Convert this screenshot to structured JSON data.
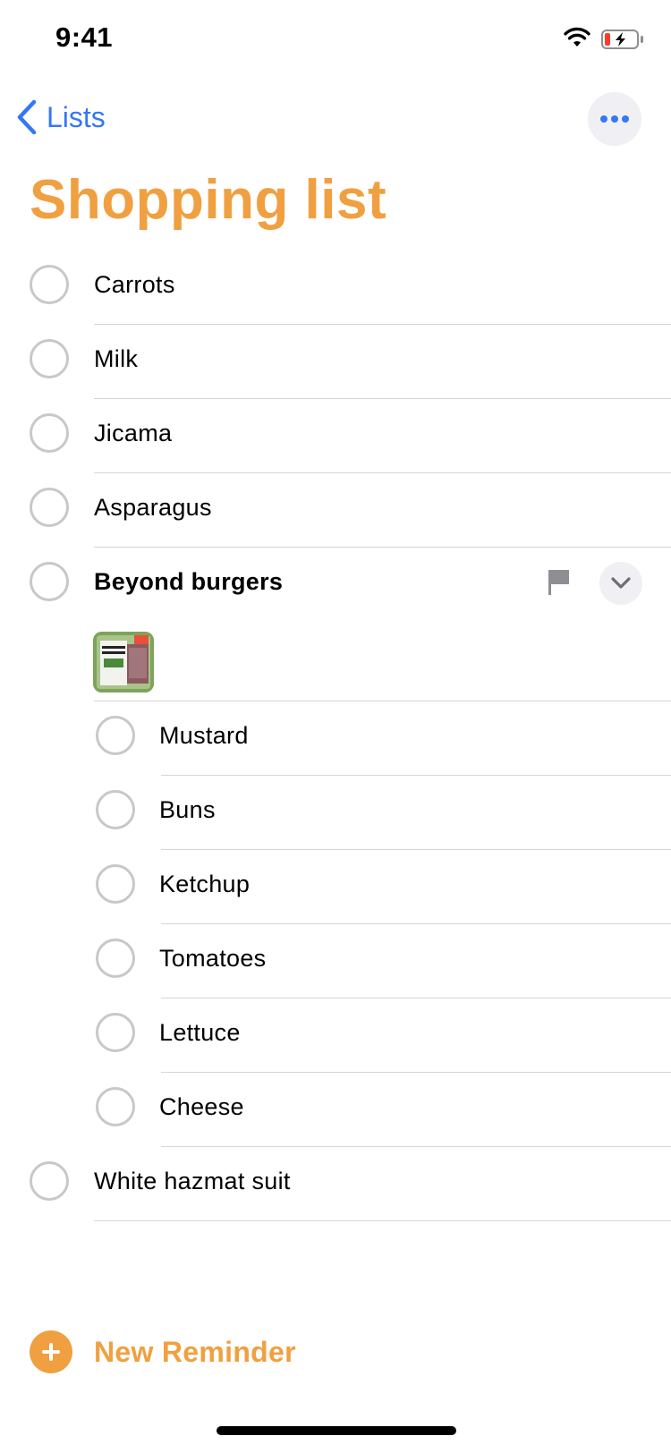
{
  "status_bar": {
    "time": "9:41"
  },
  "nav": {
    "back_label": "Lists",
    "more_icon": "ellipsis-icon"
  },
  "title": "Shopping list",
  "colors": {
    "accent": "#f0a040",
    "link": "#3478f6",
    "circle": "#c8c8cc",
    "separator": "#d6d6da"
  },
  "reminders": [
    {
      "label": "Carrots"
    },
    {
      "label": "Milk"
    },
    {
      "label": "Jicama"
    },
    {
      "label": "Asparagus"
    },
    {
      "label": "Beyond burgers",
      "flagged": true,
      "expanded": true,
      "has_attachment": true
    },
    {
      "label": "White hazmat suit"
    }
  ],
  "subtasks": [
    {
      "label": "Mustard"
    },
    {
      "label": "Buns"
    },
    {
      "label": "Ketchup"
    },
    {
      "label": "Tomatoes"
    },
    {
      "label": "Lettuce"
    },
    {
      "label": "Cheese"
    }
  ],
  "new_reminder_label": "New Reminder"
}
